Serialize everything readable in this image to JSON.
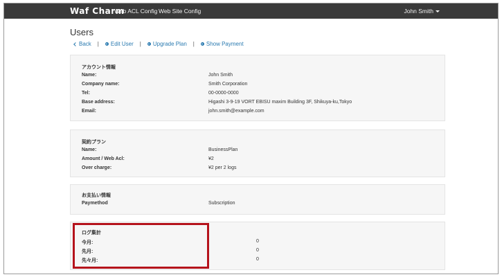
{
  "navbar": {
    "brand": "Waf Charm",
    "links": [
      "Web ACL Config",
      "Web Site Config"
    ],
    "user": "John Smith"
  },
  "page": {
    "title": "Users"
  },
  "actions": {
    "back": "Back",
    "edit_user": "Edit User",
    "upgrade_plan": "Upgrade Plan",
    "show_payment": "Show Payment",
    "separator": "|"
  },
  "account": {
    "title": "アカウント情報",
    "rows": [
      {
        "label": "Name:",
        "value": "John Smith"
      },
      {
        "label": "Company name:",
        "value": "Smith Corporation"
      },
      {
        "label": "Tel:",
        "value": "00-0000-0000"
      },
      {
        "label": "Base address:",
        "value": "Higashi 3-9-19 VORT EBISU maxim Building 3F, Shikuya-ku,Tokyo"
      },
      {
        "label": "Email:",
        "value": "john.smith@example.com"
      }
    ]
  },
  "plan": {
    "title": "契約プラン",
    "rows": [
      {
        "label": "Name:",
        "value": "BusinessPlan"
      },
      {
        "label": "Amount / Web Acl:",
        "value": "¥2"
      },
      {
        "label": "Over charge:",
        "value": "¥2 per 2 logs"
      }
    ]
  },
  "payment": {
    "title": "お支払い情報",
    "rows": [
      {
        "label": "Paymethod",
        "value": "Subscription"
      }
    ]
  },
  "logs": {
    "title": "ログ集計",
    "rows": [
      {
        "label": "今月:",
        "value": "0"
      },
      {
        "label": "先月:",
        "value": "0"
      },
      {
        "label": "先々月:",
        "value": "0"
      }
    ]
  },
  "colors": {
    "navbar": "#3a3a3a",
    "link": "#2a7ab0",
    "highlight": "#b5121b"
  }
}
